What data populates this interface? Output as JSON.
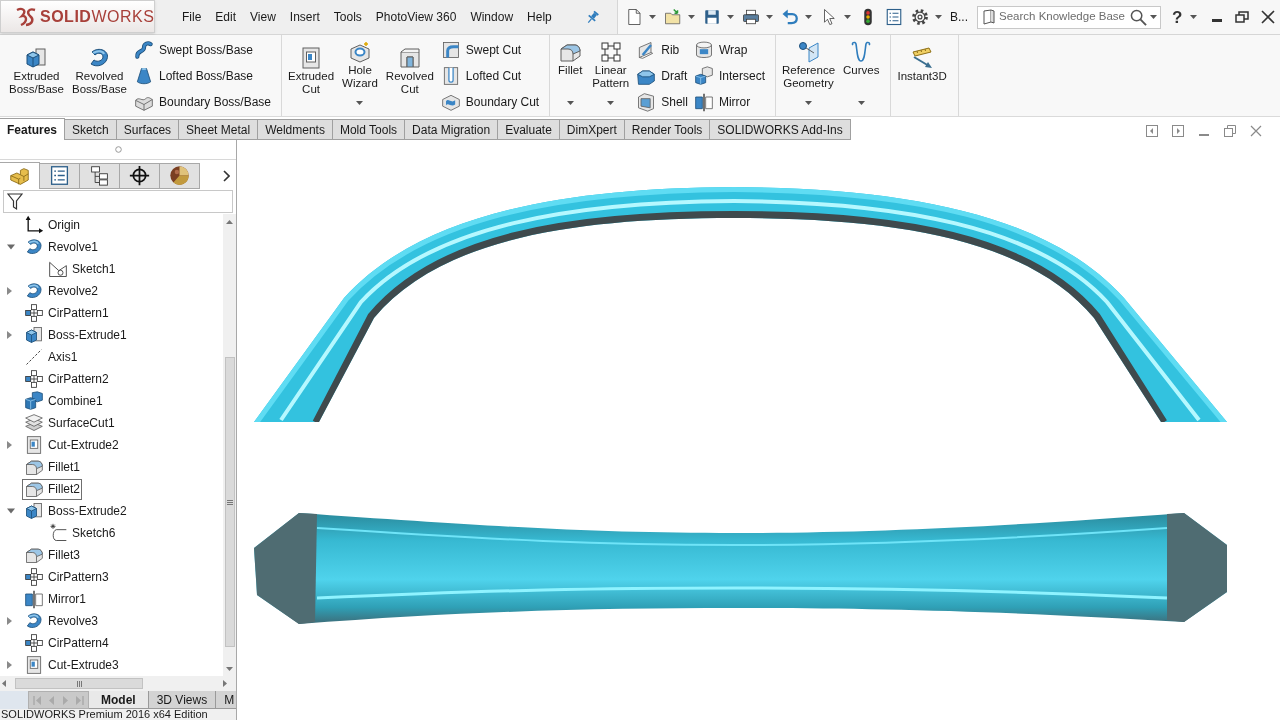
{
  "app": {
    "logo_text": "**SOLID**WORKS"
  },
  "menu": [
    "File",
    "Edit",
    "View",
    "Insert",
    "Tools",
    "PhotoView 360",
    "Window",
    "Help"
  ],
  "quick_access": [
    {
      "kind": "new",
      "dropdown": true
    },
    {
      "kind": "open",
      "dropdown": true
    },
    {
      "kind": "save",
      "dropdown": true
    },
    {
      "kind": "print",
      "dropdown": true
    },
    {
      "kind": "undo",
      "dropdown": true
    },
    {
      "kind": "select",
      "dropdown": true
    },
    {
      "kind": "rebuild",
      "dropdown": false
    },
    {
      "kind": "file-properties",
      "dropdown": false
    },
    {
      "kind": "options",
      "dropdown": true
    }
  ],
  "toolbar_overflow": "B...",
  "search": {
    "placeholder": "Search Knowledge Base"
  },
  "help": "?",
  "ribbon": [
    {
      "buttons": [
        {
          "label": "Extruded Boss/Base",
          "kind": "extrude",
          "dropdown": false
        },
        {
          "label": "Revolved Boss/Base",
          "kind": "revolve",
          "dropdown": false
        }
      ],
      "columns": [
        [
          {
            "label": "Swept Boss/Base",
            "kind": "sweep"
          },
          {
            "label": "Lofted Boss/Base",
            "kind": "loft"
          },
          {
            "label": "Boundary Boss/Base",
            "kind": "boundary"
          }
        ]
      ]
    },
    {
      "buttons": [
        {
          "label": "Extruded Cut",
          "kind": "cut-extrude",
          "dropdown": false
        },
        {
          "label": "Hole Wizard",
          "kind": "hole-wizard",
          "dropdown": true
        },
        {
          "label": "Revolved Cut",
          "kind": "revolve-cut",
          "dropdown": false
        }
      ],
      "columns": [
        [
          {
            "label": "Swept Cut",
            "kind": "sweep-cut"
          },
          {
            "label": "Lofted Cut",
            "kind": "loft-cut"
          },
          {
            "label": "Boundary Cut",
            "kind": "boundary-cut"
          }
        ]
      ]
    },
    {
      "buttons": [
        {
          "label": "Fillet",
          "kind": "fillet",
          "dropdown": true
        },
        {
          "label": "Linear Pattern",
          "kind": "linear-pattern",
          "dropdown": true
        }
      ],
      "columns": [
        [
          {
            "label": "Rib",
            "kind": "rib"
          },
          {
            "label": "Draft",
            "kind": "draft"
          },
          {
            "label": "Shell",
            "kind": "shell"
          }
        ],
        [
          {
            "label": "Wrap",
            "kind": "wrap"
          },
          {
            "label": "Intersect",
            "kind": "intersect"
          },
          {
            "label": "Mirror",
            "kind": "mirror"
          }
        ]
      ]
    },
    {
      "buttons": [
        {
          "label": "Reference Geometry",
          "kind": "reference-geometry",
          "dropdown": true
        },
        {
          "label": "Curves",
          "kind": "curves",
          "dropdown": true
        }
      ]
    },
    {
      "buttons": [
        {
          "label": "Instant3D",
          "kind": "instant3d",
          "dropdown": false
        }
      ]
    }
  ],
  "command_tabs": [
    {
      "label": "Features",
      "selected": true
    },
    {
      "label": "Sketch",
      "selected": false
    },
    {
      "label": "Surfaces",
      "selected": false
    },
    {
      "label": "Sheet Metal",
      "selected": false
    },
    {
      "label": "Weldments",
      "selected": false
    },
    {
      "label": "Mold Tools",
      "selected": false
    },
    {
      "label": "Data Migration",
      "selected": false
    },
    {
      "label": "Evaluate",
      "selected": false
    },
    {
      "label": "DimXpert",
      "selected": false
    },
    {
      "label": "Render Tools",
      "selected": false
    },
    {
      "label": "SOLIDWORKS Add-Ins",
      "selected": false
    }
  ],
  "panel_tabs": [
    {
      "kind": "feature-manager",
      "selected": true
    },
    {
      "kind": "property-manager",
      "selected": false
    },
    {
      "kind": "configuration-manager",
      "selected": false
    },
    {
      "kind": "dimxpert-manager",
      "selected": false
    },
    {
      "kind": "display-manager",
      "selected": false
    }
  ],
  "feature_tree": [
    {
      "label": "Origin",
      "kind": "origin",
      "selected": false
    },
    {
      "label": "Revolve1",
      "kind": "revolve",
      "selected": false,
      "expanded": true,
      "children": [
        {
          "label": "Sketch1",
          "kind": "sketch",
          "selected": false
        }
      ]
    },
    {
      "label": "Revolve2",
      "kind": "revolve",
      "selected": false,
      "expanded": false
    },
    {
      "label": "CirPattern1",
      "kind": "pattern",
      "selected": false
    },
    {
      "label": "Boss-Extrude1",
      "kind": "extrude",
      "selected": false,
      "expanded": false
    },
    {
      "label": "Axis1",
      "kind": "axis",
      "selected": false
    },
    {
      "label": "CirPattern2",
      "kind": "pattern",
      "selected": false
    },
    {
      "label": "Combine1",
      "kind": "combine",
      "selected": false
    },
    {
      "label": "SurfaceCut1",
      "kind": "surface-cut",
      "selected": false
    },
    {
      "label": "Cut-Extrude2",
      "kind": "cut-extrude",
      "selected": false,
      "expanded": false
    },
    {
      "label": "Fillet1",
      "kind": "fillet",
      "selected": false
    },
    {
      "label": "Fillet2",
      "kind": "fillet",
      "selected": true
    },
    {
      "label": "Boss-Extrude2",
      "kind": "extrude",
      "selected": false,
      "expanded": true,
      "children": [
        {
          "label": "Sketch6",
          "kind": "sketch-arc",
          "selected": false
        }
      ]
    },
    {
      "label": "Fillet3",
      "kind": "fillet",
      "selected": false
    },
    {
      "label": "CirPattern3",
      "kind": "pattern",
      "selected": false
    },
    {
      "label": "Mirror1",
      "kind": "mirror",
      "selected": false
    },
    {
      "label": "Revolve3",
      "kind": "revolve",
      "selected": false,
      "expanded": false
    },
    {
      "label": "CirPattern4",
      "kind": "pattern",
      "selected": false
    },
    {
      "label": "Cut-Extrude3",
      "kind": "cut-extrude",
      "selected": false,
      "expanded": false
    }
  ],
  "bottom_tabs": [
    {
      "label": "Model",
      "selected": true
    },
    {
      "label": "3D Views",
      "selected": false
    },
    {
      "label": "M",
      "selected": false
    }
  ],
  "status_bar": "SOLIDWORKS Premium 2016 x64 Edition"
}
